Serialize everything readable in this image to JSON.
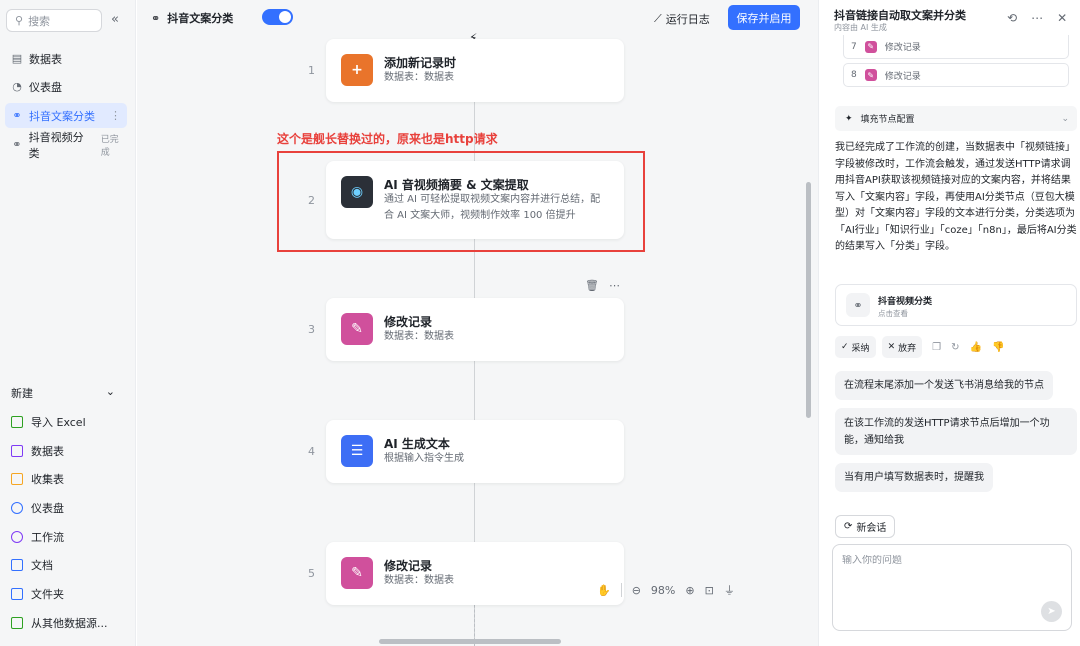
{
  "sidebar": {
    "search_placeholder": "搜索",
    "items": [
      {
        "label": "数据表",
        "tag": ""
      },
      {
        "label": "仪表盘",
        "tag": ""
      },
      {
        "label": "抖音文案分类",
        "tag": ""
      },
      {
        "label": "抖音视频分类",
        "tag": "已完成"
      }
    ],
    "new_header": "新建",
    "new_items": [
      {
        "label": "导入 Excel",
        "color": "#2ea121"
      },
      {
        "label": "数据表",
        "color": "#7f3bf5"
      },
      {
        "label": "收集表",
        "color": "#f5a623"
      },
      {
        "label": "仪表盘",
        "color": "#3370ff"
      },
      {
        "label": "工作流",
        "color": "#7f3bf5"
      },
      {
        "label": "文档",
        "color": "#3370ff"
      },
      {
        "label": "文件夹",
        "color": "#3370ff"
      },
      {
        "label": "从其他数据源...",
        "color": "#2ea121"
      }
    ]
  },
  "canvas": {
    "workflow_title": "抖音文案分类",
    "run_log": "运行日志",
    "save_button": "保存并启用",
    "annotation": "这个是舰长替换过的，原来也是http请求",
    "zoom": "98%",
    "nodes": [
      {
        "num": "1",
        "title": "添加新记录时",
        "sub": "数据表：数据表",
        "icon_color": "#e9742b",
        "icon": "+"
      },
      {
        "num": "2",
        "title": "AI 音视频摘要 & 文案提取",
        "sub": "通过 AI 可轻松提取视频文案内容并进行总结，配合 AI 文案大师，视频制作效率 100 倍提升",
        "icon_color": "#2b3038",
        "icon": "◉"
      },
      {
        "num": "3",
        "title": "修改记录",
        "sub": "数据表：数据表",
        "icon_color": "#d0509c",
        "icon": "✎"
      },
      {
        "num": "4",
        "title": "AI 生成文本",
        "sub": "根据输入指令生成",
        "icon_color": "#3d6ef5",
        "icon": "☰"
      },
      {
        "num": "5",
        "title": "修改记录",
        "sub": "数据表：数据表",
        "icon_color": "#d0509c",
        "icon": "✎"
      }
    ]
  },
  "panel": {
    "title": "抖音链接自动取文案并分类",
    "subtitle": "内容由 AI 生成",
    "steps": [
      {
        "num": "7",
        "label": "修改记录"
      },
      {
        "num": "8",
        "label": "修改记录"
      }
    ],
    "fill_config": "填充节点配置",
    "message": "我已经完成了工作流的创建，当数据表中「视频链接」字段被修改时，工作流会触发，通过发送HTTP请求调用抖音API获取该视频链接对应的文案内容，并将结果写入「文案内容」字段，再使用AI分类节点（豆包大模型）对「文案内容」字段的文本进行分类，分类选项为「AI行业」「知识行业」「coze」「n8n」，最后将AI分类的结果写入「分类」字段。",
    "card_title": "抖音视频分类",
    "card_sub": "点击查看",
    "adopt": "采纳",
    "discard": "放弃",
    "suggestions": [
      "在流程末尾添加一个发送飞书消息给我的节点",
      "在该工作流的发送HTTP请求节点后增加一个功能，通知给我",
      "当有用户填写数据表时，提醒我"
    ],
    "new_chat": "新会话",
    "input_placeholder": "输入你的问题"
  }
}
